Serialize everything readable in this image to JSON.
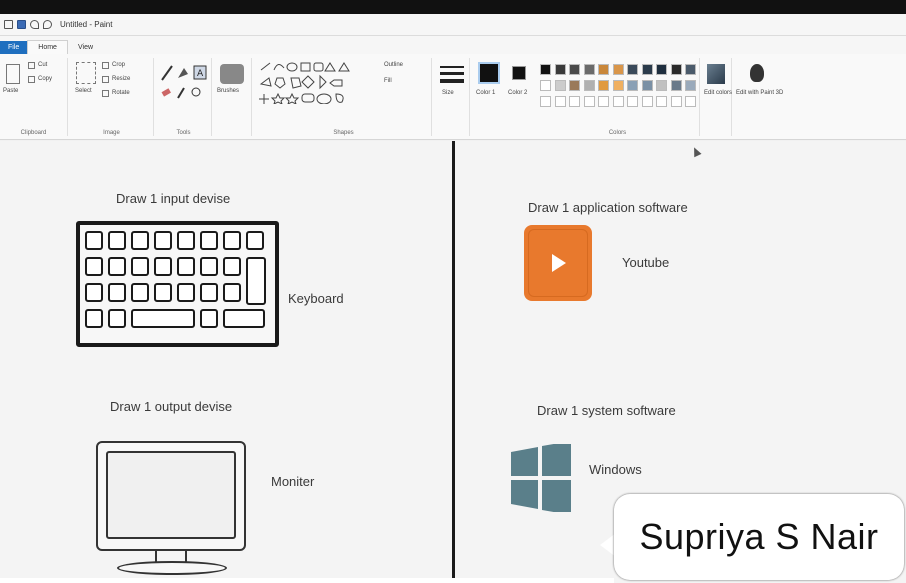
{
  "titlebar": {
    "title": "Untitled - Paint"
  },
  "tabs": [
    "File",
    "Home",
    "View"
  ],
  "ribbon": {
    "clipboard": {
      "paste": "Paste",
      "cut": "Cut",
      "copy": "Copy",
      "label": "Clipboard"
    },
    "image": {
      "select": "Select",
      "crop": "Crop",
      "resize": "Resize",
      "rotate": "Rotate",
      "label": "Image"
    },
    "tools": {
      "label": "Tools"
    },
    "brushes": {
      "label": "Brushes"
    },
    "shapes": {
      "outline": "Outline",
      "fill": "Fill",
      "label": "Shapes"
    },
    "size": {
      "label": "Size"
    },
    "color1": {
      "label": "Color 1"
    },
    "color2": {
      "label": "Color 2"
    },
    "colors": {
      "label": "Colors"
    },
    "edit_colors": {
      "label": "Edit colors"
    },
    "paint3d": {
      "label": "Edit with Paint 3D"
    }
  },
  "palette": {
    "row1": [
      "#111111",
      "#3a3a3a",
      "#4a4a4a",
      "#6a6a6a",
      "#c9873a",
      "#d9964a",
      "#3a4a5a",
      "#2b3b4b",
      "#1f2f3f",
      "#2a2a2a",
      "#4b5b6b"
    ],
    "row2": [
      "#ffffff",
      "#cccccc",
      "#9a7a5a",
      "#b0b0b0",
      "#e09a40",
      "#f0b060",
      "#8aa0b5",
      "#7a90a5",
      "#c0c0c0",
      "#6a7a8a",
      "#9aaabb"
    ],
    "row3": [
      "#ffffff",
      "#ffffff",
      "#ffffff",
      "#ffffff",
      "#ffffff",
      "#ffffff",
      "#ffffff",
      "#ffffff",
      "#ffffff",
      "#ffffff",
      "#ffffff"
    ]
  },
  "canvas": {
    "input_device": {
      "heading": "Draw 1 input devise",
      "caption": "Keyboard"
    },
    "application_software": {
      "heading": "Draw 1 application software",
      "caption": "Youtube"
    },
    "output_device": {
      "heading": "Draw 1 output devise",
      "caption": "Moniter"
    },
    "system_software": {
      "heading": "Draw 1 system software",
      "caption": "Windows"
    }
  },
  "callout": {
    "text": "Supriya S Nair"
  },
  "colors": {
    "youtube": "#e8792d",
    "windows": "#5a7f8a",
    "file_tab": "#1f6fbf"
  }
}
